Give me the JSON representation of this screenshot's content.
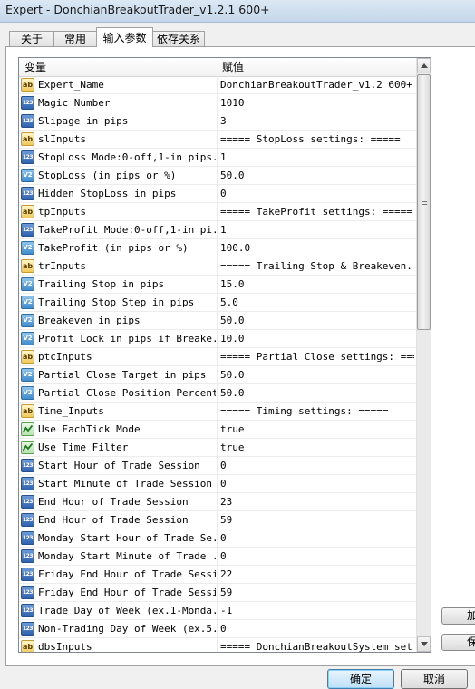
{
  "window": {
    "title": "Expert - DonchianBreakoutTrader_v1.2.1 600+"
  },
  "tabs": [
    {
      "label": "关于"
    },
    {
      "label": "常用"
    },
    {
      "label": "输入参数"
    },
    {
      "label": "依存关系"
    }
  ],
  "grid": {
    "headers": {
      "variable": "变量",
      "value": "赋值"
    },
    "rows": [
      {
        "type": "string",
        "icon": "ab",
        "name": "Expert_Name",
        "value": "DonchianBreakoutTrader_v1.2 600+"
      },
      {
        "type": "int",
        "icon": "123",
        "name": "Magic Number",
        "value": "1010"
      },
      {
        "type": "int",
        "icon": "123",
        "name": "Slipage in pips",
        "value": "3"
      },
      {
        "type": "string",
        "icon": "ab",
        "name": "slInputs",
        "value": "===== StopLoss settings: ====="
      },
      {
        "type": "int",
        "icon": "123",
        "name": "StopLoss Mode:0-off,1-in pips...",
        "value": "1"
      },
      {
        "type": "double",
        "icon": "V2",
        "name": "StopLoss (in pips or %)",
        "value": "50.0"
      },
      {
        "type": "int",
        "icon": "123",
        "name": "Hidden StopLoss in pips",
        "value": "0"
      },
      {
        "type": "string",
        "icon": "ab",
        "name": "tpInputs",
        "value": "===== TakeProfit settings: ====="
      },
      {
        "type": "int",
        "icon": "123",
        "name": "TakeProfit Mode:0-off,1-in pi...",
        "value": "1"
      },
      {
        "type": "double",
        "icon": "V2",
        "name": "TakeProfit (in pips or %)",
        "value": "100.0"
      },
      {
        "type": "string",
        "icon": "ab",
        "name": "trInputs",
        "value": "===== Trailing Stop & Breakeven..."
      },
      {
        "type": "double",
        "icon": "V2",
        "name": "Trailing Stop in pips",
        "value": "15.0"
      },
      {
        "type": "double",
        "icon": "V2",
        "name": "Trailing Stop Step in pips",
        "value": "5.0"
      },
      {
        "type": "double",
        "icon": "V2",
        "name": "Breakeven in pips",
        "value": "50.0"
      },
      {
        "type": "double",
        "icon": "V2",
        "name": "Profit Lock in pips if Breake...",
        "value": "10.0"
      },
      {
        "type": "string",
        "icon": "ab",
        "name": "ptcInputs",
        "value": "===== Partial Close settings: ====="
      },
      {
        "type": "double",
        "icon": "V2",
        "name": "Partial Close Target in pips",
        "value": "50.0"
      },
      {
        "type": "double",
        "icon": "V2",
        "name": "Partial Close Position Percent",
        "value": "50.0"
      },
      {
        "type": "string",
        "icon": "ab",
        "name": "Time_Inputs",
        "value": "===== Timing settings: ====="
      },
      {
        "type": "bool",
        "icon": "bool",
        "name": "Use EachTick Mode",
        "value": "true"
      },
      {
        "type": "bool",
        "icon": "bool",
        "name": "Use Time Filter",
        "value": "true"
      },
      {
        "type": "int",
        "icon": "123",
        "name": "Start Hour of Trade Session",
        "value": "0"
      },
      {
        "type": "int",
        "icon": "123",
        "name": "Start Minute of Trade Session",
        "value": "0"
      },
      {
        "type": "int",
        "icon": "123",
        "name": "End Hour of Trade Session",
        "value": "23"
      },
      {
        "type": "int",
        "icon": "123",
        "name": "End Hour of Trade Session",
        "value": "59"
      },
      {
        "type": "int",
        "icon": "123",
        "name": "Monday Start Hour of Trade Se...",
        "value": "0"
      },
      {
        "type": "int",
        "icon": "123",
        "name": "Monday Start Minute of Trade ...",
        "value": "0"
      },
      {
        "type": "int",
        "icon": "123",
        "name": "Friday End Hour of Trade Session",
        "value": "22"
      },
      {
        "type": "int",
        "icon": "123",
        "name": "Friday End Hour of Trade Session",
        "value": "59"
      },
      {
        "type": "int",
        "icon": "123",
        "name": "Trade Day of Week (ex.1-Monda...",
        "value": "-1"
      },
      {
        "type": "int",
        "icon": "123",
        "name": "Non-Trading Day of Week (ex.5...",
        "value": "0"
      },
      {
        "type": "string",
        "icon": "ab",
        "name": "dbsInputs",
        "value": "===== DonchianBreakoutSystem set..."
      }
    ]
  },
  "side_buttons": {
    "load": "加",
    "save": "保"
  },
  "buttons": {
    "ok": "确定",
    "cancel": "取消"
  }
}
